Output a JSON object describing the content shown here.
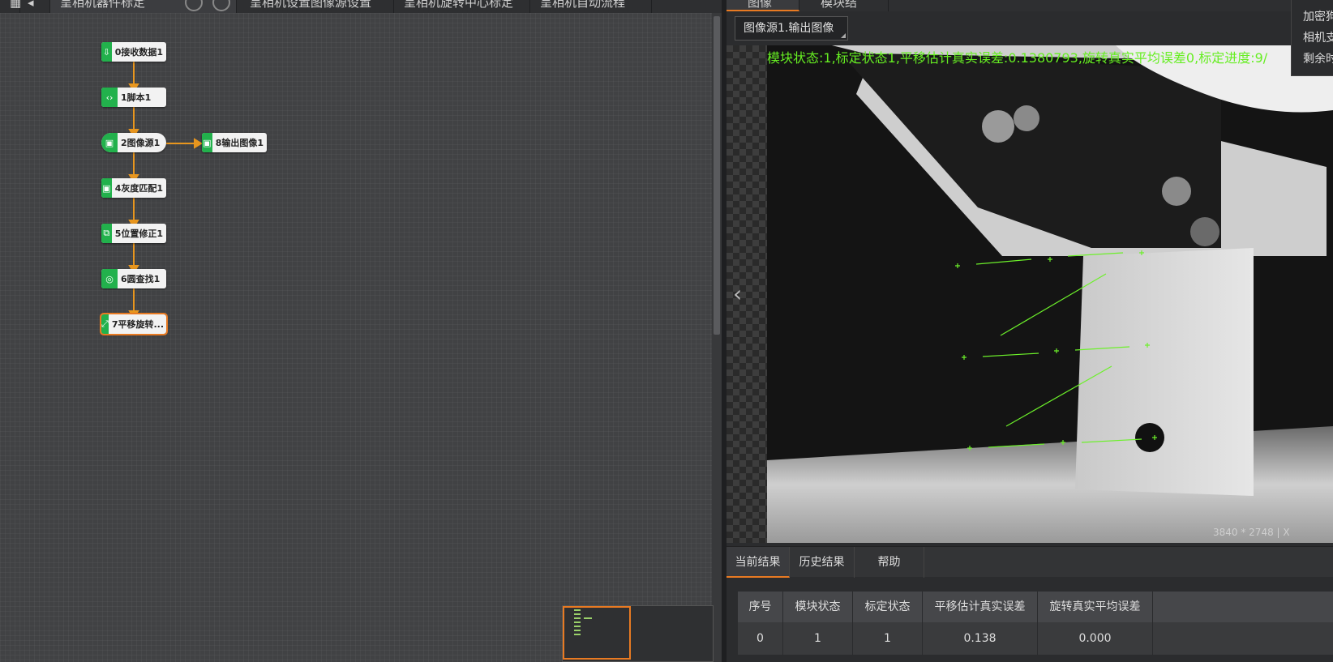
{
  "top_tabs": [
    {
      "label": "呈相机器件标定",
      "active": true
    },
    {
      "label": "呈相机设置图像源设置"
    },
    {
      "label": "呈相机旋转中心标定"
    },
    {
      "label": "呈相机自动流程"
    }
  ],
  "flow": {
    "nodes": [
      {
        "id": "n0",
        "label": "0接收数据1",
        "icon": "receive-data-icon"
      },
      {
        "id": "n1",
        "label": "1脚本1",
        "icon": "script-icon"
      },
      {
        "id": "n2",
        "label": "2图像源1",
        "icon": "image-source-icon"
      },
      {
        "id": "n8",
        "label": "8输出图像1",
        "icon": "output-image-icon"
      },
      {
        "id": "n4",
        "label": "4灰度匹配1",
        "icon": "gray-match-icon"
      },
      {
        "id": "n5",
        "label": "5位置修正1",
        "icon": "position-fix-icon"
      },
      {
        "id": "n6",
        "label": "6圆查找1",
        "icon": "circle-find-icon"
      },
      {
        "id": "n7",
        "label": "7平移旋转...",
        "icon": "calib-icon"
      }
    ],
    "accent": "#e87a22",
    "node_icon_color": "#22b14c"
  },
  "right_tabs": [
    {
      "label": "图像",
      "active": true
    },
    {
      "label": "模块结果"
    }
  ],
  "image_source_select": "图像源1.输出图像",
  "overlay_text": "模块状态:1,标定状态1,平移估计真实误差:0.1380793,旋转真实平均误差0,标定进度:9/",
  "image_size": "3840 * 2748",
  "coord_prefix": "| X",
  "info_popup": [
    "加密狗",
    "相机支",
    "剩余时"
  ],
  "result_tabs": [
    "当前结果",
    "历史结果",
    "帮助"
  ],
  "result_table": {
    "headers": [
      "序号",
      "模块状态",
      "标定状态",
      "平移估计真实误差",
      "旋转真实平均误差"
    ],
    "rows": [
      [
        "0",
        "1",
        "1",
        "0.138",
        "0.000"
      ]
    ]
  }
}
